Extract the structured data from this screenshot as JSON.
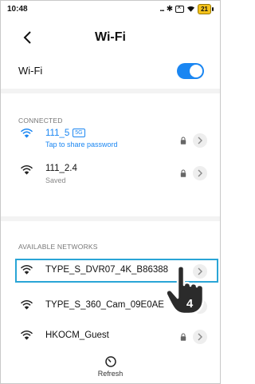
{
  "status_bar": {
    "time": "10:48",
    "signal_dots": "...",
    "battery": "21"
  },
  "header": {
    "title": "Wi-Fi"
  },
  "wifi_toggle": {
    "label": "Wi-Fi",
    "enabled": true,
    "color": "#1a86f2"
  },
  "connected": {
    "heading": "CONNECTED",
    "networks": [
      {
        "name": "111_5",
        "band": "5G",
        "status": "Tap to share password",
        "secured": true,
        "active": true
      },
      {
        "name": "111_2.4",
        "status": "Saved",
        "secured": true,
        "active": false
      }
    ]
  },
  "available": {
    "heading": "AVAILABLE NETWORKS",
    "networks": [
      {
        "name": "TYPE_S_DVR07_4K_B86388",
        "secured": false,
        "highlighted": true
      },
      {
        "name": "TYPE_S_360_Cam_09E0AE",
        "secured": false,
        "highlighted": false
      },
      {
        "name": "HKOCM_Guest",
        "secured": true,
        "highlighted": false
      }
    ]
  },
  "annotation": {
    "step_number": "4",
    "highlight_color": "#2aa5d6"
  },
  "footer": {
    "refresh_label": "Refresh"
  },
  "icons": {
    "wifi": "wifi-icon",
    "lock": "lock-icon",
    "chevron": "chevron-right-icon",
    "refresh": "refresh-icon",
    "back": "back-arrow-icon"
  }
}
